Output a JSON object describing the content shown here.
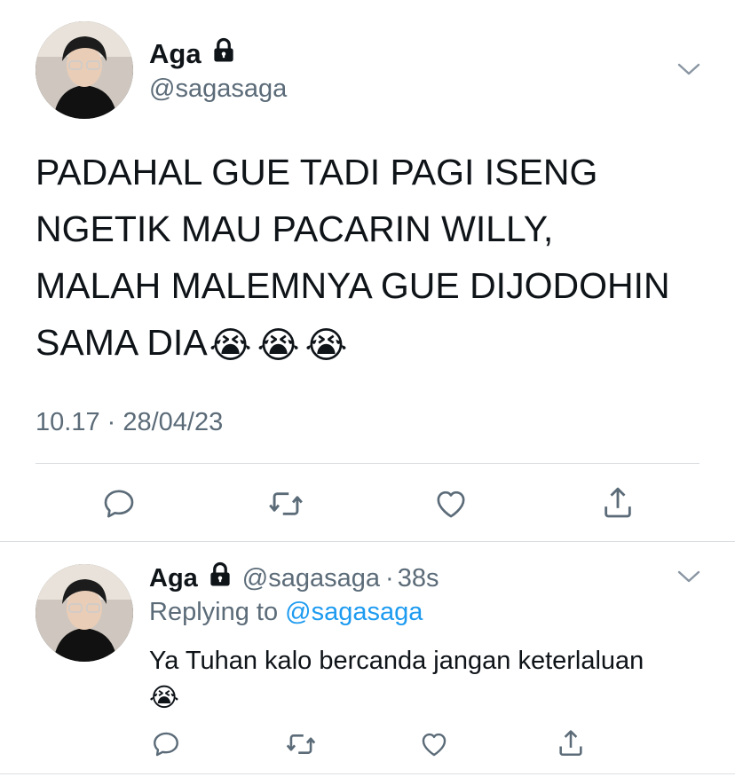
{
  "main_tweet": {
    "author_name": "Aga",
    "author_handle": "@sagasaga",
    "lines": [
      "PADAHAL GUE TADI PAGI ISENG",
      "NGETIK MAU PACARIN WILLY,",
      "MALAH MALEMNYA GUE DIJODOHIN",
      "SAMA DIA"
    ],
    "emojis": [
      "😭",
      "😭",
      "😭"
    ],
    "timestamp": "10.17 · 28/04/23",
    "icons": [
      "reply-icon",
      "retweet-icon",
      "like-icon",
      "share-icon",
      "lock-icon",
      "chevron-down-icon"
    ]
  },
  "reply_tweet": {
    "author_name": "Aga",
    "author_handle": "@sagasaga",
    "separator": "·",
    "age": "38s",
    "replying_prefix": "Replying to",
    "replying_to": "@sagasaga",
    "text": "Ya Tuhan kalo bercanda jangan keterlaluan",
    "emoji": "😭"
  },
  "colors": {
    "text": "#0f1419",
    "secondary": "#5b6b78",
    "link": "#1d9bf0",
    "divider": "#dcdfe2"
  }
}
